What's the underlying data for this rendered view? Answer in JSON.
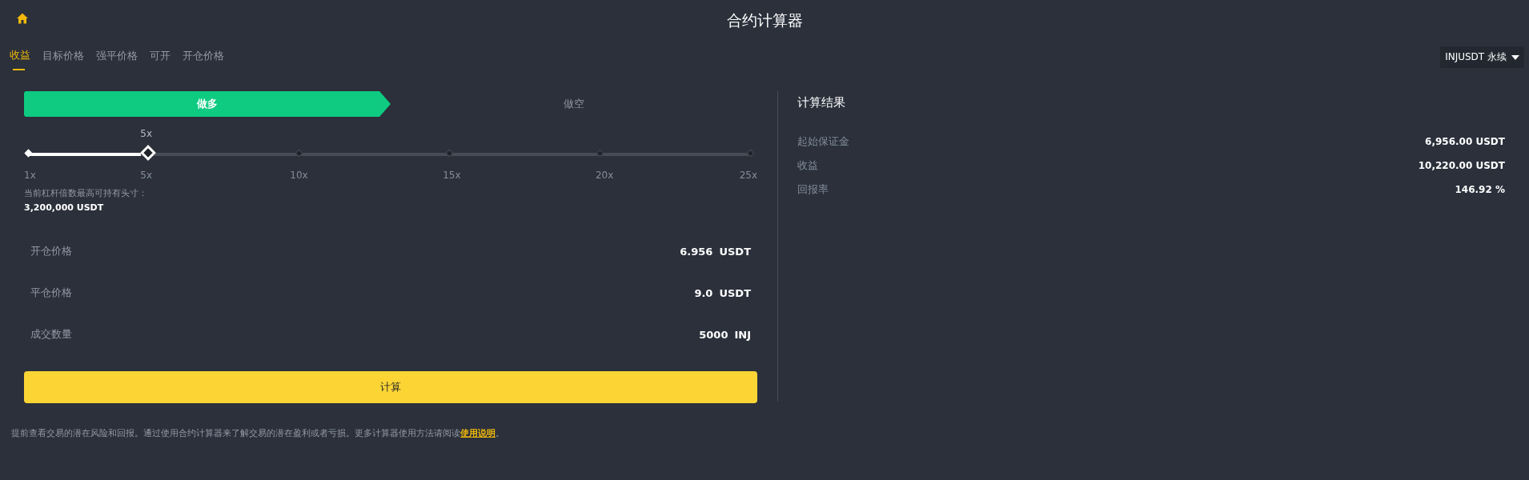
{
  "header": {
    "title": "合约计算器"
  },
  "tabs": [
    {
      "label": "收益",
      "selected": true
    },
    {
      "label": "目标价格",
      "selected": false
    },
    {
      "label": "强平价格",
      "selected": false
    },
    {
      "label": "可开",
      "selected": false
    },
    {
      "label": "开仓价格",
      "selected": false
    }
  ],
  "pair_selector": {
    "label": "INJUSDT 永续"
  },
  "side_toggle": [
    {
      "label": "做多",
      "selected": true
    },
    {
      "label": "做空",
      "selected": false
    }
  ],
  "leverage": {
    "value_label": "5x",
    "level": 0.1667,
    "marks": [
      "1x",
      "5x",
      "10x",
      "15x",
      "20x",
      "25x"
    ]
  },
  "max_position": {
    "label": "当前杠杆倍数最高可持有头寸：",
    "value": "3,200,000 USDT"
  },
  "inputs": [
    {
      "label": "开仓价格",
      "value": "6.956",
      "unit": "USDT"
    },
    {
      "label": "平仓价格",
      "value": "9.0",
      "unit": "USDT"
    },
    {
      "label": "成交数量",
      "value": "5000",
      "unit": "INJ"
    }
  ],
  "calculate_button": {
    "label": "计算"
  },
  "results": {
    "title": "计算结果",
    "rows": [
      {
        "label": "起始保证金",
        "value": "6,956.00 USDT"
      },
      {
        "label": "收益",
        "value": "10,220.00 USDT"
      },
      {
        "label": "回报率",
        "value": "146.92 %"
      }
    ]
  },
  "footer": {
    "text": "提前查看交易的潜在风险和回报。通过使用合约计算器来了解交易的潜在盈利或者亏损。更多计算器使用方法请阅读",
    "link": "使用说明",
    "end": "。"
  }
}
